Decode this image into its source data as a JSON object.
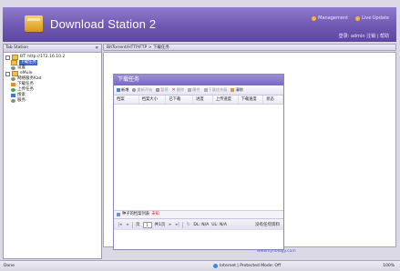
{
  "app": {
    "title": "Download Station 2"
  },
  "top_links": {
    "management": "Management",
    "live_update": "Live Update"
  },
  "user_line": {
    "text": "登录: admin  注销  | 帮助"
  },
  "left_panel": {
    "title": "Tab Station",
    "collapse": "«",
    "tree": [
      {
        "label": "BT: http://172.16.10.2",
        "icon": "folder-icon",
        "indent": 0,
        "selected": false
      },
      {
        "label": "下载任务",
        "icon": "folder-icon",
        "indent": 1,
        "selected": true
      },
      {
        "label": "设置",
        "icon": "gear-icon",
        "indent": 1,
        "selected": false
      },
      {
        "label": "eMule",
        "icon": "folder-icon",
        "indent": 0,
        "selected": false
      },
      {
        "label": "网络服务Kad",
        "icon": "gear-icon",
        "indent": 1,
        "selected": false
      },
      {
        "label": "下载任务",
        "icon": "orange-icon",
        "indent": 1,
        "selected": false
      },
      {
        "label": "上传任务",
        "icon": "green-icon",
        "indent": 1,
        "selected": false
      },
      {
        "label": "搜索",
        "icon": "blue-icon",
        "indent": 1,
        "selected": false
      },
      {
        "label": "服务",
        "icon": "gear-icon",
        "indent": 1,
        "selected": false
      }
    ]
  },
  "breadcrumb": "BitTorrent/HTTP/FTP > 下载任务",
  "task_window": {
    "title": "下载任务",
    "toolbar": [
      {
        "label": "新增",
        "icon": "new-icon",
        "enabled": true
      },
      {
        "label": "重新开始",
        "icon": "start-icon",
        "enabled": false
      },
      {
        "label": "暂停",
        "icon": "stop-icon",
        "enabled": false
      },
      {
        "label": "删除",
        "icon": "delete-icon",
        "enabled": false
      },
      {
        "label": "属性",
        "icon": "properties-icon",
        "enabled": false
      },
      {
        "label": "下载优先级",
        "icon": "priority-icon",
        "enabled": false
      },
      {
        "label": "清除",
        "icon": "clear-icon",
        "enabled": true
      }
    ],
    "columns": [
      "档案",
      "档案大小",
      "已下载",
      "进度",
      "上传速度",
      "下载速度",
      "状态"
    ],
    "sub_bar": {
      "label": "种子的档案列表",
      "value": "未知"
    },
    "pager": {
      "page_label": "页",
      "page_value": "1",
      "total_label": "共1页",
      "dl_speed": "DL: N/A",
      "ul_speed": "UL: N/A",
      "right_text": "没有任何资料"
    }
  },
  "footer_url": "www.synology.com",
  "statusbar": {
    "status": "Done",
    "mode": "Internet | Protected Mode: Off",
    "zoom": "100%"
  }
}
